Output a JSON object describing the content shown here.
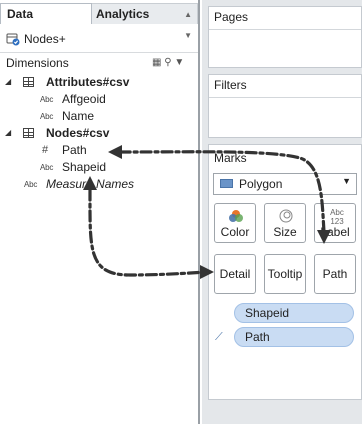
{
  "tabs": {
    "data": "Data",
    "analytics": "Analytics"
  },
  "datasource": {
    "label": "Nodes+"
  },
  "dimensions": {
    "title": "Dimensions",
    "tables": [
      {
        "name": "Attributes#csv",
        "fields": [
          {
            "type": "Abc",
            "name": "Affgeoid"
          },
          {
            "type": "Abc",
            "name": "Name"
          }
        ]
      },
      {
        "name": "Nodes#csv",
        "fields": [
          {
            "type": "#",
            "name": "Path"
          },
          {
            "type": "Abc",
            "name": "Shapeid"
          }
        ]
      }
    ],
    "extra": {
      "type": "Abc",
      "name": "Measure Names"
    }
  },
  "pages": {
    "title": "Pages"
  },
  "filters": {
    "title": "Filters"
  },
  "marks": {
    "title": "Marks",
    "mark_type": "Polygon",
    "buttons": {
      "color": "Color",
      "size": "Size",
      "label": "Label",
      "detail": "Detail",
      "tooltip": "Tooltip",
      "path": "Path"
    },
    "label_icon_text": "Abc 123",
    "pills": [
      {
        "name": "Shapeid"
      },
      {
        "name": "Path"
      }
    ]
  }
}
